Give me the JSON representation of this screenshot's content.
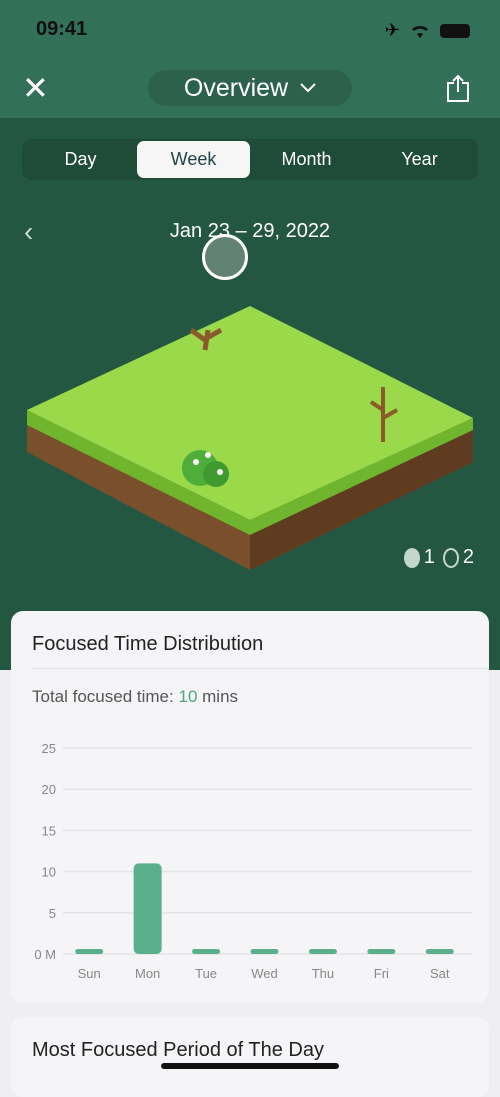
{
  "status": {
    "time": "09:41"
  },
  "header": {
    "title": "Overview"
  },
  "tabs": [
    {
      "label": "Day"
    },
    {
      "label": "Week",
      "selected": true
    },
    {
      "label": "Month"
    },
    {
      "label": "Year"
    }
  ],
  "date_range": "Jan 23 – 29, 2022",
  "tree_counts": {
    "healthy": "1",
    "dead": "2"
  },
  "card1": {
    "title": "Focused Time Distribution",
    "total_label": "Total focused time:",
    "total_value": "10",
    "total_unit": "mins"
  },
  "card2": {
    "title": "Most Focused Period of The Day"
  },
  "chart_data": {
    "type": "bar",
    "categories": [
      "Sun",
      "Mon",
      "Tue",
      "Wed",
      "Thu",
      "Fri",
      "Sat"
    ],
    "values": [
      0,
      11,
      0,
      0,
      0,
      0,
      0
    ],
    "yticks": [
      "0 M",
      "5",
      "10",
      "15",
      "20",
      "25"
    ],
    "ylim": [
      0,
      25
    ],
    "grid": true,
    "color": "#5bb08b"
  }
}
